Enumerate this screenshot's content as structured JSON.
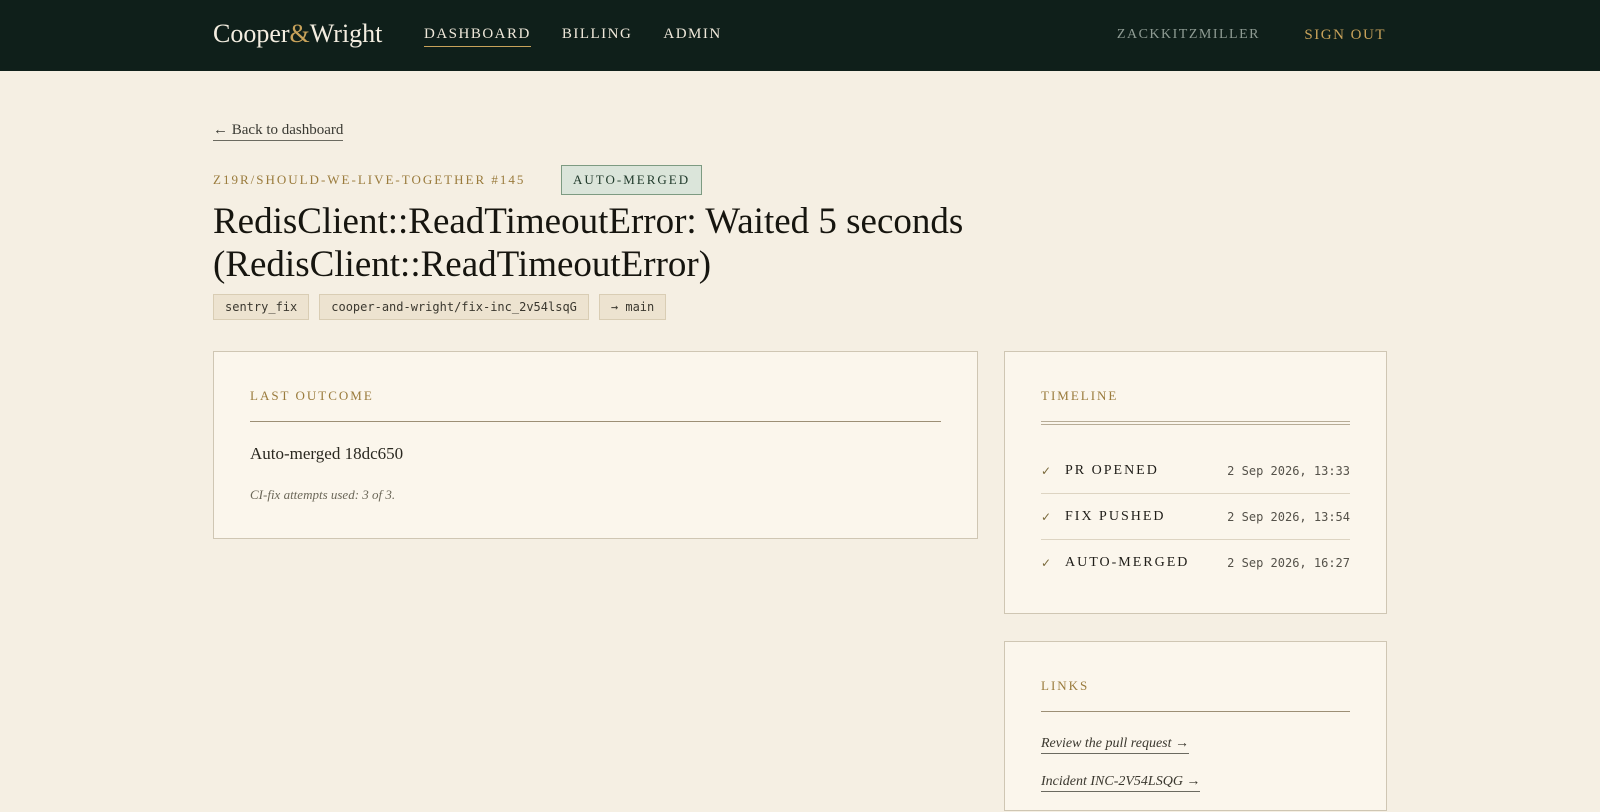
{
  "header": {
    "logo_left": "Cooper",
    "logo_amp": "&",
    "logo_right": "Wright",
    "nav": [
      {
        "label": "DASHBOARD",
        "active": true
      },
      {
        "label": "BILLING",
        "active": false
      },
      {
        "label": "ADMIN",
        "active": false
      }
    ],
    "username": "ZACKKITZMILLER",
    "signout_label": "SIGN OUT"
  },
  "back_link": "← Back to dashboard",
  "pr": {
    "repo_ref": "Z19R/SHOULD-WE-LIVE-TOGETHER #145",
    "status": "AUTO-MERGED",
    "title": "RedisClient::ReadTimeoutError: Waited 5 seconds (RedisClient::ReadTimeoutError)",
    "tags": [
      "sentry_fix",
      "cooper-and-wright/fix-inc_2v54lsqG",
      "→ main"
    ]
  },
  "outcome": {
    "label": "LAST OUTCOME",
    "main": "Auto-merged 18dc650",
    "note": "CI-fix attempts used: 3 of 3."
  },
  "timeline": {
    "label": "TIMELINE",
    "items": [
      {
        "check": "✓",
        "label": "PR OPENED",
        "time": "2 Sep 2026, 13:33"
      },
      {
        "check": "✓",
        "label": "FIX PUSHED",
        "time": "2 Sep 2026, 13:54"
      },
      {
        "check": "✓",
        "label": "AUTO-MERGED",
        "time": "2 Sep 2026, 16:27"
      }
    ]
  },
  "links": {
    "label": "LINKS",
    "items": [
      "Review the pull request →",
      "Incident INC-2V54LSQG →"
    ]
  },
  "colors": {
    "background": "#f5efe3",
    "header": "#0f1f1a",
    "accent_gold": "#c8a25a",
    "badge_green": "#dbe5da"
  }
}
